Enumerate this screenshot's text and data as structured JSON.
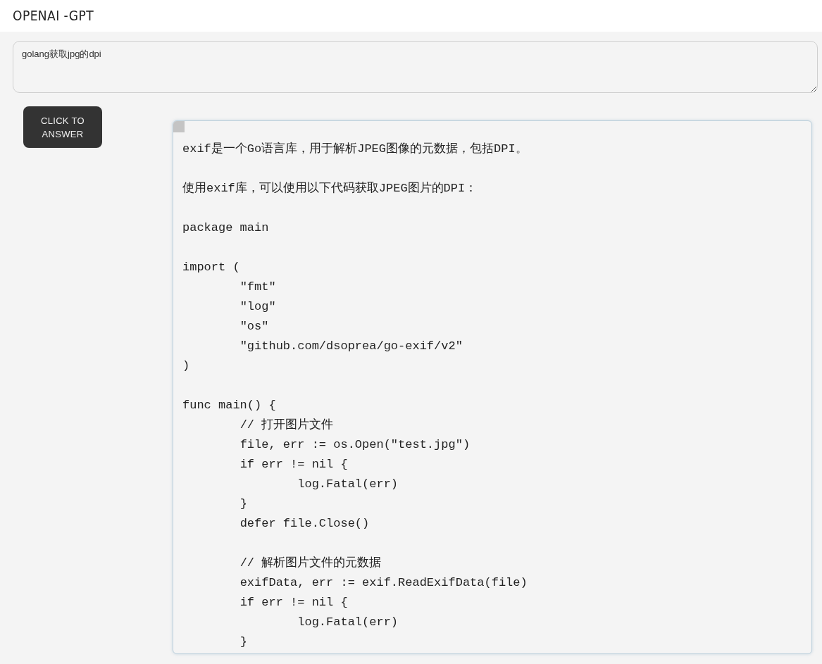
{
  "header": {
    "title": "OPENAI -GPT"
  },
  "question": {
    "value": "golang获取jpg的dpi"
  },
  "answer_button": {
    "label": "CLICK TO\nANSWER"
  },
  "answer": {
    "blocks": [
      [
        "exif是一个Go语言库，用于解析JPEG图像的元数据，包括DPI。"
      ],
      [
        "使用exif库，可以使用以下代码获取JPEG图片的DPI："
      ],
      [
        "package main"
      ],
      [
        "import (",
        "\t\"fmt\"",
        "\t\"log\"",
        "\t\"os\"",
        "\t\"github.com/dsoprea/go-exif/v2\"",
        ")"
      ],
      [
        "func main() {",
        "\t// 打开图片文件",
        "\tfile, err := os.Open(\"test.jpg\")",
        "\tif err != nil {",
        "\t\tlog.Fatal(err)",
        "\t}",
        "\tdefer file.Close()"
      ],
      [
        "\t// 解析图片文件的元数据",
        "\texifData, err := exif.ReadExifData(file)",
        "\tif err != nil {",
        "\t\tlog.Fatal(err)",
        "\t}"
      ]
    ]
  }
}
